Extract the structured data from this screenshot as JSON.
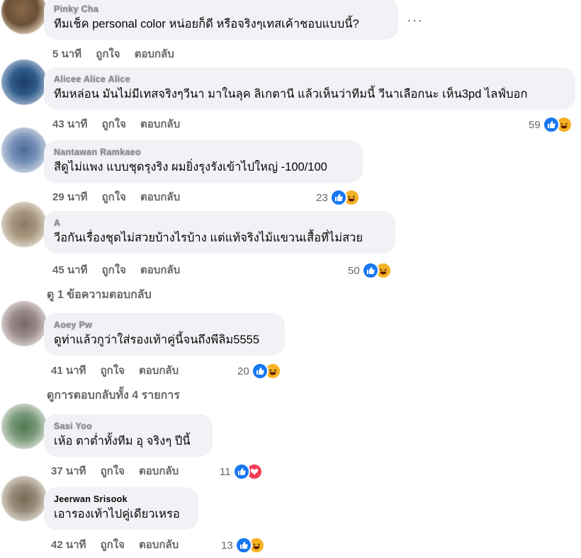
{
  "comments": [
    {
      "author": "Pinky Cha",
      "author_clear": false,
      "text": "ทีมเช็ค personal color หน่อยก็ดี หรือจริงๆเทสเค้าชอบแบบนี้?",
      "time": "5 นาที",
      "like": "ถูกใจ",
      "reply": "ตอบกลับ",
      "reaction_count": ""
    },
    {
      "author": "Alicee Alice Alice",
      "author_clear": false,
      "text": "ทีมหล่อน มันไม่มีเทสจริงๆวีนา มาในลุค ลิเกตานี แล้วเห็นว่าทีมนี้ วีนาเลือกนะ เห็น3pd ไลฟ์บอก",
      "time": "43 นาที",
      "like": "ถูกใจ",
      "reply": "ตอบกลับ",
      "reaction_count": "59"
    },
    {
      "author": "Nantawan Ramkaeo",
      "author_clear": false,
      "text": "สีดูไม่แพง แบบชุดรุงริง ผมยิ่งรุงรังเข้าไปใหญ่ -100/100",
      "time": "29 นาที",
      "like": "ถูกใจ",
      "reply": "ตอบกลับ",
      "reaction_count": "23"
    },
    {
      "author": "A",
      "author_clear": false,
      "text": "วีอกันเรื่องชุดไม่สวยบ้างไรบ้าง แต่แท้จริงไม้แขวนเสื้อที่ไม่สวย",
      "time": "45 นาที",
      "like": "ถูกใจ",
      "reply": "ตอบกลับ",
      "reaction_count": "50"
    },
    {
      "author": "Aoey Pw",
      "author_clear": false,
      "text": "ดูท่าแล้วกูว่าใส่รองเท้าคู่นี้จนถึงพีลิม5555",
      "time": "41 นาที",
      "like": "ถูกใจ",
      "reply": "ตอบกลับ",
      "reaction_count": "20"
    },
    {
      "author": "Sasi Yoo",
      "author_clear": false,
      "text": "เห้อ ตาต่ำทั้งทีม อุ จริงๆ ปีนี้",
      "time": "37 นาที",
      "like": "ถูกใจ",
      "reply": "ตอบกลับ",
      "reaction_count": "11"
    },
    {
      "author": "Jeerwan Srisook",
      "author_clear": true,
      "text": "เอารองเท้าไปคู่เดียวเหรอ",
      "time": "42 นาที",
      "like": "ถูกใจ",
      "reply": "ตอบกลับ",
      "reaction_count": "13"
    }
  ],
  "view_replies_1": "ดู 1 ข้อความตอบกลับ",
  "view_replies_all": "ดูการตอบกลับทั้ง 4 รายการ",
  "more_options": "···",
  "colors": {
    "bubble": "#f0f2f5",
    "meta": "#65676b",
    "like_blue": "#1877f2",
    "haha_yellow": "#f7b125",
    "love_red": "#f33e58"
  },
  "icons": [
    "thumbs-up-icon",
    "haha-icon",
    "heart-icon",
    "more-options-icon"
  ]
}
